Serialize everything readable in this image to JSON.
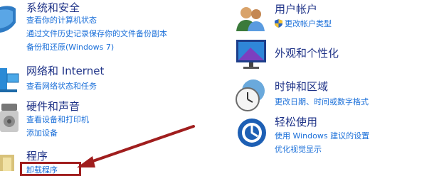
{
  "left": {
    "system": {
      "title": "系统和安全",
      "links": [
        "查看你的计算机状态",
        "通过文件历史记录保存你的文件备份副本",
        "备份和还原(Windows 7)"
      ]
    },
    "network": {
      "title": "网络和 Internet",
      "links": [
        "查看网络状态和任务"
      ]
    },
    "hardware": {
      "title": "硬件和声音",
      "links": [
        "查看设备和打印机",
        "添加设备"
      ]
    },
    "programs": {
      "title": "程序",
      "links": [
        "卸载程序"
      ]
    }
  },
  "right": {
    "user": {
      "title": "用户帐户",
      "links": [
        "更改帐户类型"
      ]
    },
    "appearance": {
      "title": "外观和个性化"
    },
    "clock": {
      "title": "时钟和区域",
      "links": [
        "更改日期、时间或数字格式"
      ]
    },
    "ease": {
      "title": "轻松使用",
      "links": [
        "使用 Windows 建议的设置",
        "优化视觉显示"
      ]
    }
  },
  "colors": {
    "title": "#1e3287",
    "link": "#1a6fd9",
    "annotation": "#a01e1e"
  }
}
